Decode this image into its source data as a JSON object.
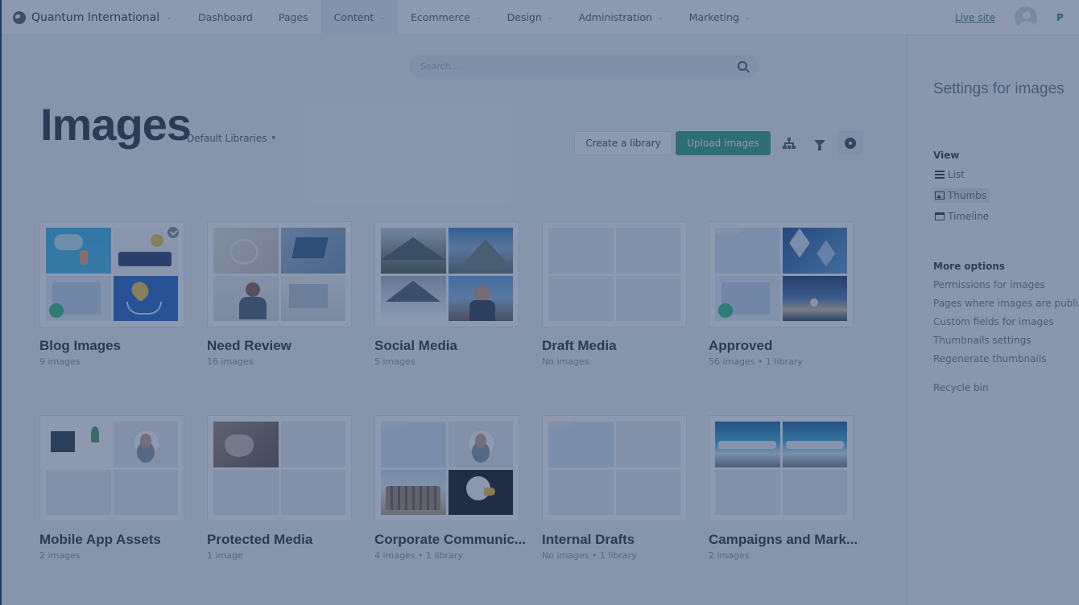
{
  "topbar": {
    "site_name": "Quantum International",
    "nav": [
      {
        "label": "Dashboard",
        "dropdown": false,
        "active": false
      },
      {
        "label": "Pages",
        "dropdown": false,
        "active": false
      },
      {
        "label": "Content",
        "dropdown": true,
        "active": true
      },
      {
        "label": "Ecommerce",
        "dropdown": true,
        "active": false
      },
      {
        "label": "Design",
        "dropdown": true,
        "active": false
      },
      {
        "label": "Administration",
        "dropdown": true,
        "active": false
      },
      {
        "label": "Marketing",
        "dropdown": true,
        "active": false
      }
    ],
    "live_site_label": "Live site",
    "extra_label": "P"
  },
  "search": {
    "placeholder": "Search..."
  },
  "page": {
    "title": "Images",
    "library_selector": "Default Libraries"
  },
  "toolbar": {
    "create_label": "Create a library",
    "upload_label": "Upload images",
    "tree_icon": "sitemap-icon",
    "filter_icon": "filter-icon",
    "settings_icon": "gear-icon"
  },
  "libraries": [
    {
      "name": "Blog Images",
      "meta": "9 images",
      "cells": [
        "img-cloud",
        "img-people",
        "img-hero",
        "img-hearts"
      ],
      "checked": true
    },
    {
      "name": "Need Review",
      "meta": "16 images",
      "cells": [
        "img-office1",
        "img-laptop",
        "img-meeting",
        "img-desk"
      ]
    },
    {
      "name": "Social Media",
      "meta": "5 images",
      "cells": [
        "img-mount1",
        "img-mount2",
        "img-snow",
        "img-hiker"
      ]
    },
    {
      "name": "Draft Media",
      "meta": "No images",
      "cells": [
        "",
        "",
        "",
        ""
      ]
    },
    {
      "name": "Approved",
      "meta": "56 images  •  1 library",
      "cells": [
        "img-folder",
        "img-cubes",
        "img-hero",
        "img-sunset"
      ]
    },
    {
      "name": "Mobile App Assets",
      "meta": "2 images",
      "cells": [
        "img-workdesk",
        "img-portrait",
        "",
        ""
      ]
    },
    {
      "name": "Protected Media",
      "meta": "1 image",
      "cells": [
        "img-cat",
        "",
        "",
        ""
      ]
    },
    {
      "name": "Corporate Communic...",
      "meta": "4 images  •  1 library",
      "cells": [
        "img-folder",
        "img-portrait",
        "img-colosseum",
        "img-eagle"
      ]
    },
    {
      "name": "Internal Drafts",
      "meta": "No images  •  1 library",
      "cells": [
        "img-folder",
        "",
        "",
        ""
      ]
    },
    {
      "name": "Campaigns and Mark...",
      "meta": "2 images",
      "cells": [
        "img-beach",
        "img-beach",
        "",
        ""
      ]
    }
  ],
  "panel": {
    "title": "Settings for images",
    "view_heading": "View",
    "view_options": [
      {
        "label": "List",
        "icon": "list-icon",
        "active": false
      },
      {
        "label": "Thumbs",
        "icon": "thumbs-icon",
        "active": true
      },
      {
        "label": "Timeline",
        "icon": "calendar-icon",
        "active": false
      }
    ],
    "more_heading": "More options",
    "more_links": [
      "Permissions for images",
      "Pages where images are publis",
      "Custom fields for images",
      "Thumbnails settings",
      "Regenerate thumbnails"
    ],
    "recycle_label": "Recycle bin"
  },
  "colors": {
    "accent": "#2f9e74",
    "overlay": "#2e4670"
  }
}
